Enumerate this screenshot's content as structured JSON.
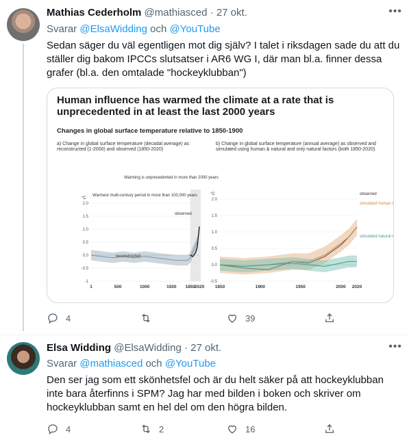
{
  "tweet1": {
    "name": "Mathias Cederholm",
    "handle": "@mathiasced",
    "dot": "·",
    "date": "27 okt.",
    "reply_prefix": "Svarar",
    "reply_to1": "@ElsaWidding",
    "reply_and": "och",
    "reply_to2": "@YouTube",
    "text": "Sedan säger du väl egentligen mot dig själv? I talet i riksdagen sade du att du ställer dig bakom IPCCs slutsatser i AR6 WG I, där man bl.a. finner dessa grafer (bl.a. den omtalade \"hockeyklubban\")",
    "replies": "4",
    "retweets": "",
    "likes": "39"
  },
  "figure": {
    "title": "Human influence has warmed the climate at a rate that is unprecedented in at least the last 2000 years",
    "subtitle": "Changes in global surface temperature relative to 1850-1900",
    "panel_a_label": "a) Change in global surface temperature (decadal average) as reconstructed (1-2000) and observed (1850-2020)",
    "panel_b_label": "b) Change in global surface temperature (annual average) as observed and simulated using human & natural and only natural factors (both 1850-2020)",
    "unit": "°C",
    "annot_unprecedented": "Warming is unprecedented in more than 2000 years",
    "annot_warmest": "Warmest multi-century period in more than 100,000 years",
    "label_reconstructed": "reconstructed",
    "label_observed_a": "observed",
    "label_observed_b": "observed",
    "label_sim_human": "simulated human & natural",
    "label_sim_natural": "simulated natural only (solar & volcanic)",
    "colors": {
      "observed": "#111111",
      "reconstructed": "#8fa3b2",
      "human": "#e3a878",
      "natural": "#6fbfb0"
    }
  },
  "chart_data": [
    {
      "type": "line",
      "title": "a) Change in global surface temperature (decadal average) as reconstructed (1-2000) and observed (1850-2020)",
      "xlabel": "",
      "ylabel": "°C",
      "xticks": [
        "1",
        "500",
        "1000",
        "1500",
        "1850",
        "2020"
      ],
      "yticks": [
        "-1",
        "-0.5",
        "0.0",
        "0.5",
        "1.0",
        "1.5",
        "2.0"
      ],
      "ylim": [
        -1,
        2
      ],
      "series": [
        {
          "name": "reconstructed",
          "x": [
            1,
            200,
            400,
            600,
            800,
            1000,
            1200,
            1400,
            1600,
            1800,
            1850,
            2000
          ],
          "y": [
            0.0,
            -0.05,
            -0.1,
            -0.05,
            -0.1,
            -0.05,
            -0.1,
            -0.15,
            -0.2,
            -0.2,
            -0.1,
            0.6
          ]
        },
        {
          "name": "observed",
          "x": [
            1850,
            1900,
            1950,
            1980,
            2000,
            2020
          ],
          "y": [
            0.0,
            -0.05,
            0.1,
            0.3,
            0.7,
            1.1
          ]
        }
      ]
    },
    {
      "type": "line",
      "title": "b) Change in global surface temperature (annual average) as observed and simulated using human & natural and only natural factors (both 1850-2020)",
      "xlabel": "",
      "ylabel": "°C",
      "xticks": [
        "1850",
        "1900",
        "1950",
        "2000",
        "2020"
      ],
      "yticks": [
        "-0.5",
        "0.0",
        "0.5",
        "1.0",
        "1.5",
        "2.0"
      ],
      "ylim": [
        -0.5,
        2
      ],
      "series": [
        {
          "name": "observed",
          "x": [
            1850,
            1880,
            1910,
            1940,
            1960,
            1980,
            2000,
            2010,
            2020
          ],
          "y": [
            0.0,
            -0.1,
            -0.15,
            0.1,
            0.05,
            0.25,
            0.6,
            0.85,
            1.15
          ]
        },
        {
          "name": "simulated human & natural",
          "x": [
            1850,
            1880,
            1910,
            1940,
            1960,
            1980,
            2000,
            2010,
            2020
          ],
          "y": [
            0.0,
            -0.05,
            0.0,
            0.1,
            0.1,
            0.3,
            0.65,
            0.85,
            1.15
          ]
        },
        {
          "name": "simulated natural only (solar & volcanic)",
          "x": [
            1850,
            1880,
            1910,
            1940,
            1960,
            1980,
            2000,
            2010,
            2020
          ],
          "y": [
            0.0,
            -0.05,
            0.0,
            0.05,
            0.0,
            -0.05,
            0.05,
            0.1,
            0.1
          ]
        }
      ]
    }
  ],
  "tweet2": {
    "name": "Elsa Widding",
    "handle": "@ElsaWidding",
    "dot": "·",
    "date": "27 okt.",
    "reply_prefix": "Svarar",
    "reply_to1": "@mathiasced",
    "reply_and": "och",
    "reply_to2": "@YouTube",
    "text": "Den ser jag som ett skönhetsfel och är du helt säker på att hockeyklubban inte bara återfinns i SPM? Jag har med bilden i boken och skriver om hockeyklubban samt en hel del om den högra bilden.",
    "replies": "4",
    "retweets": "2",
    "likes": "16"
  },
  "icons": [
    "more-icon",
    "reply-icon",
    "retweet-icon",
    "like-icon",
    "share-icon"
  ]
}
